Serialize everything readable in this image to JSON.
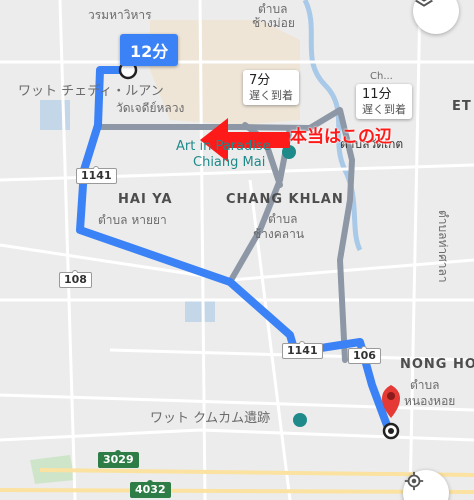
{
  "colors": {
    "route": "#3b82f6",
    "route_alt": "#9aa4b2",
    "annotation": "#ff1a1a",
    "park": "#2e8b57",
    "pin": "#e53935"
  },
  "route": {
    "main_time": "12分",
    "alt1_time": "7分",
    "alt1_note": "遅く到着",
    "alt2_time": "11分",
    "alt2_note": "遅く到着"
  },
  "annotation": {
    "text": "本当はこの辺"
  },
  "places": {
    "top_left_thai": "วรมหาวิหาร",
    "top_center_thai_1": "ตำบล",
    "top_center_thai_2": "ช้างม่อย",
    "wat_jp": "ワット チェディ・ルアン",
    "wat_thai": "วัดเจดีย์หลวง",
    "art_1": "Art in Paradise",
    "art_2": "Chiang Mai",
    "haiya_en": "HAI YA",
    "haiya_th": "ตำบล หายยา",
    "changkhlan_en": "CHANG KHLAN",
    "changkhlan_th_1": "ตำบล",
    "changkhlan_th_2": "ช้างคลาน",
    "nonghoi_en": "NONG HOI",
    "nonghoi_th_1": "ตำบล",
    "nonghoi_th_2": "หนองหอย",
    "kumkam_jp": "ワット クムカム遺跡",
    "right_thai_partial": "ตำบลท่าศาลา",
    "right_partial_en": "ET",
    "right_partial_th": "ตำบลวัดเกต",
    "top_right_partial": "Ch..."
  },
  "roads": {
    "r1141_a": "1141",
    "r1141_b": "1141",
    "r108": "108",
    "r106": "106",
    "r3029": "3029",
    "r4032": "4032"
  },
  "icons": {
    "layers": "layers-icon",
    "location": "my-location-icon",
    "pin": "destination-pin-icon",
    "start": "start-dot-icon"
  }
}
